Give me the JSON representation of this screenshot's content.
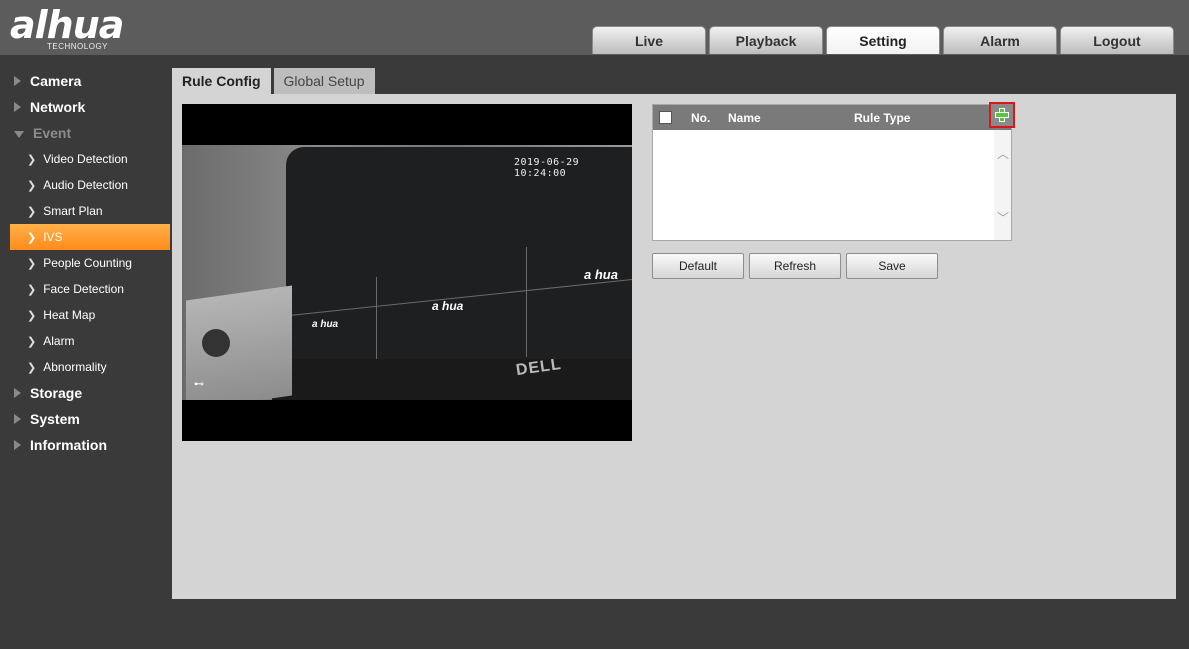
{
  "logo": {
    "main": "alhua",
    "sub": "TECHNOLOGY"
  },
  "topnav": [
    {
      "label": "Live",
      "active": false
    },
    {
      "label": "Playback",
      "active": false
    },
    {
      "label": "Setting",
      "active": true
    },
    {
      "label": "Alarm",
      "active": false
    },
    {
      "label": "Logout",
      "active": false
    }
  ],
  "sidebar": {
    "items": [
      {
        "label": "Camera"
      },
      {
        "label": "Network"
      },
      {
        "label": "Event"
      },
      {
        "label": "Storage"
      },
      {
        "label": "System"
      },
      {
        "label": "Information"
      }
    ],
    "event_sub": [
      {
        "label": "Video Detection"
      },
      {
        "label": "Audio Detection"
      },
      {
        "label": "Smart Plan"
      },
      {
        "label": "IVS"
      },
      {
        "label": "People Counting"
      },
      {
        "label": "Face Detection"
      },
      {
        "label": "Heat Map"
      },
      {
        "label": "Alarm"
      },
      {
        "label": "Abnormality"
      }
    ]
  },
  "subtabs": [
    {
      "label": "Rule Config",
      "active": true
    },
    {
      "label": "Global Setup",
      "active": false
    }
  ],
  "video": {
    "osd_time": "2019-06-29 10:24:00",
    "brand_marks": [
      "a hua",
      "a hua",
      "a hua"
    ],
    "dell_label": "DELL"
  },
  "rule_table": {
    "headers": {
      "no": "No.",
      "name": "Name",
      "rule_type": "Rule Type"
    },
    "add_icon": "plus-icon",
    "up_arrow": "︿",
    "down_arrow": "﹀"
  },
  "buttons": {
    "default": "Default",
    "refresh": "Refresh",
    "save": "Save"
  },
  "colors": {
    "accent": "#ff9a2e",
    "highlight": "#d8161b",
    "plus": "#5bc33e"
  }
}
